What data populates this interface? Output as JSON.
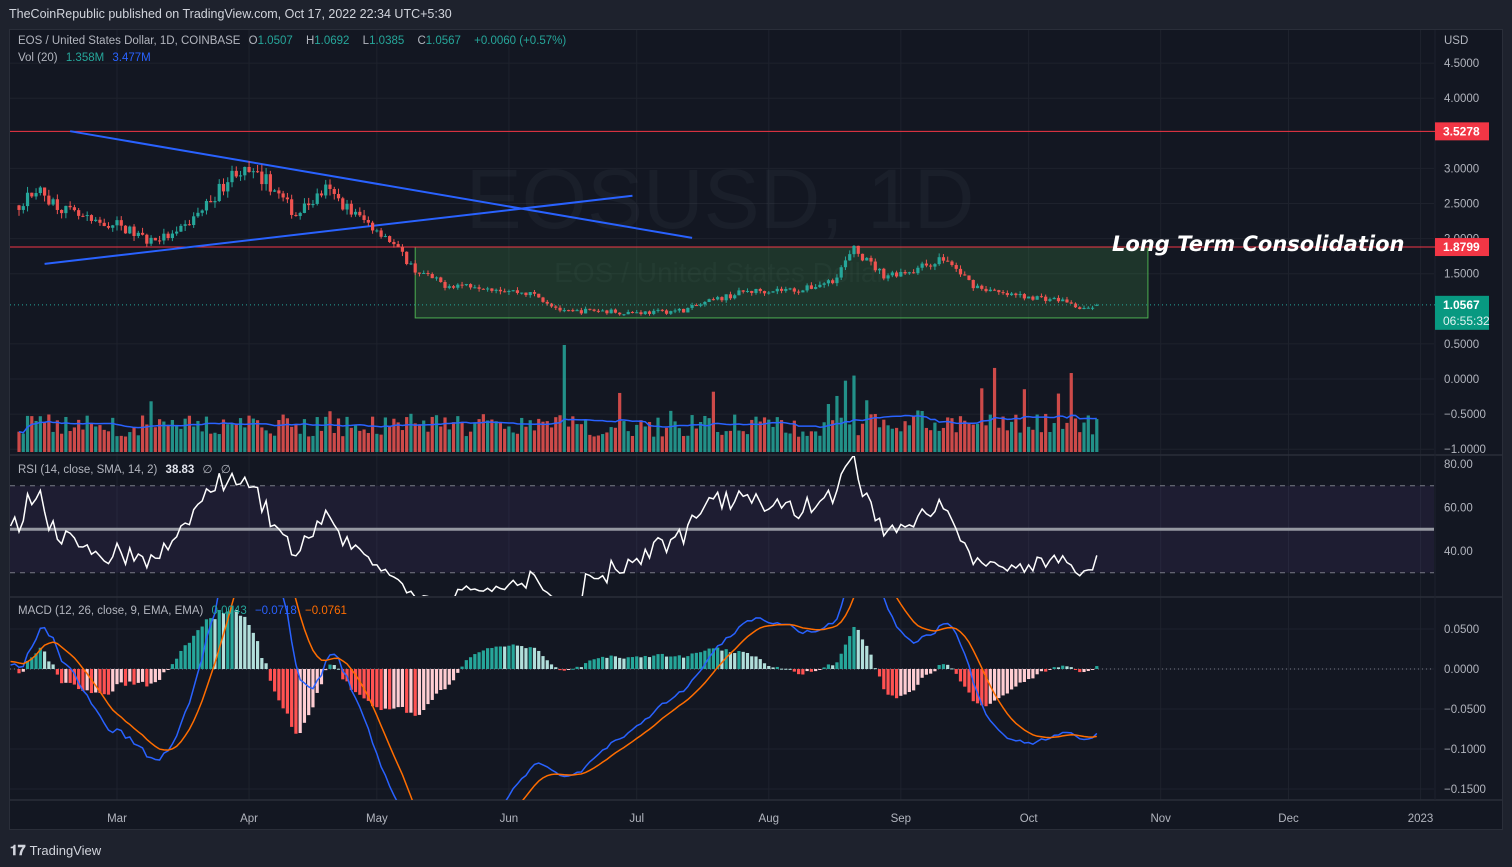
{
  "header": {
    "published": "TheCoinRepublic published on TradingView.com, Oct 17, 2022 22:34 UTC+5:30"
  },
  "legend": {
    "symbol": "EOS / United States Dollar, 1D, COINBASE",
    "o_label": "O",
    "o": "1.0507",
    "h_label": "H",
    "h": "1.0692",
    "l_label": "L",
    "l": "1.0385",
    "c_label": "C",
    "c": "1.0567",
    "change": "+0.0060 (+0.57%)",
    "vol_label": "Vol (20)",
    "vol": "1.358M",
    "vol_ma": "3.477M",
    "rsi_label": "RSI (14, close, SMA, 14, 2)",
    "rsi_value": "38.83",
    "rsi_extra1": "∅",
    "rsi_extra2": "∅",
    "macd_label": "MACD (12, 26, close, 9, EMA, EMA)",
    "macd_hist": "0.0043",
    "macd_line": "−0.0718",
    "macd_signal": "−0.0761"
  },
  "watermark": {
    "line1": "EOSUSD, 1D",
    "line2": "EOS / United States Dollar"
  },
  "annotation": {
    "text": "Long Term Consolidation"
  },
  "price_axis": {
    "unit": "USD",
    "ticks": [
      "4.5000",
      "4.0000",
      "3.0000",
      "2.5000",
      "2.0000",
      "1.5000",
      "0.5000",
      "0.0000",
      "−0.5000",
      "−1.0000"
    ],
    "tick_values": [
      4.5,
      4,
      3,
      2.5,
      2,
      1.5,
      0.5,
      0,
      -0.5,
      -1
    ],
    "resistance_label": "3.5278",
    "support_label": "1.8799",
    "last_price": "1.0567",
    "countdown": "06:55:32"
  },
  "rsi_axis": {
    "ticks": [
      "80.00",
      "60.00",
      "40.00"
    ],
    "tick_values": [
      80,
      60,
      40
    ]
  },
  "macd_axis": {
    "ticks": [
      "0.0500",
      "0.0000",
      "−0.0500",
      "−0.1000",
      "−0.1500"
    ],
    "tick_values": [
      0.05,
      0,
      -0.05,
      -0.1,
      -0.15
    ]
  },
  "time_axis": {
    "labels": [
      "Mar",
      "Apr",
      "May",
      "Jun",
      "Jul",
      "Aug",
      "Sep",
      "Oct",
      "Nov",
      "Dec",
      "2023"
    ],
    "dates": [
      "2022-03-01",
      "2022-04-01",
      "2022-05-01",
      "2022-06-01",
      "2022-07-01",
      "2022-08-01",
      "2022-09-01",
      "2022-10-01",
      "2022-11-01",
      "2022-12-01",
      "2023-01-01"
    ]
  },
  "footer": {
    "brand": "TradingView"
  },
  "colors": {
    "up": "#26a69a",
    "down": "#ef5350",
    "level": "#f23645",
    "trend": "#2962ff",
    "box": "#4caf50",
    "macd": "#2962ff",
    "signal": "#ff6d00",
    "rsi": "#ffffff"
  },
  "chart_data": {
    "type": "candlestick",
    "title": "EOS / United States Dollar, 1D, COINBASE",
    "ylabel": "USD",
    "ylim": [
      -1.0,
      4.7
    ],
    "close_anchors": [
      [
        "2022-01-20",
        2.5
      ],
      [
        "2022-02-05",
        2.41
      ],
      [
        "2022-02-10",
        2.7
      ],
      [
        "2022-02-17",
        2.4
      ],
      [
        "2022-02-24",
        2.2
      ],
      [
        "2022-03-01",
        2.2
      ],
      [
        "2022-03-08",
        1.98
      ],
      [
        "2022-03-15",
        2.05
      ],
      [
        "2022-03-22",
        2.48
      ],
      [
        "2022-03-29",
        2.98
      ],
      [
        "2022-04-05",
        2.83
      ],
      [
        "2022-04-12",
        2.34
      ],
      [
        "2022-04-19",
        2.7
      ],
      [
        "2022-04-26",
        2.34
      ],
      [
        "2022-05-03",
        2.05
      ],
      [
        "2022-05-10",
        1.55
      ],
      [
        "2022-05-17",
        1.34
      ],
      [
        "2022-05-24",
        1.34
      ],
      [
        "2022-05-31",
        1.27
      ],
      [
        "2022-06-07",
        1.2
      ],
      [
        "2022-06-14",
        0.95
      ],
      [
        "2022-06-21",
        0.98
      ],
      [
        "2022-06-28",
        0.95
      ],
      [
        "2022-07-05",
        0.95
      ],
      [
        "2022-07-12",
        0.98
      ],
      [
        "2022-07-19",
        1.12
      ],
      [
        "2022-07-26",
        1.24
      ],
      [
        "2022-08-02",
        1.27
      ],
      [
        "2022-08-09",
        1.27
      ],
      [
        "2022-08-16",
        1.41
      ],
      [
        "2022-08-21",
        1.84
      ],
      [
        "2022-08-28",
        1.48
      ],
      [
        "2022-09-04",
        1.55
      ],
      [
        "2022-09-11",
        1.72
      ],
      [
        "2022-09-18",
        1.34
      ],
      [
        "2022-09-25",
        1.2
      ],
      [
        "2022-10-02",
        1.17
      ],
      [
        "2022-10-09",
        1.12
      ],
      [
        "2022-10-14",
        0.98
      ],
      [
        "2022-10-17",
        1.0567
      ]
    ],
    "volume_spikes": [
      [
        "2022-06-14",
        4.2
      ],
      [
        "2022-08-19",
        2.8
      ],
      [
        "2022-08-21",
        3.0
      ],
      [
        "2022-09-23",
        3.3
      ],
      [
        "2022-10-11",
        3.1
      ],
      [
        "2022-04-20",
        1.6
      ],
      [
        "2022-05-09",
        1.5
      ],
      [
        "2022-06-16",
        1.4
      ],
      [
        "2022-08-17",
        2.2
      ],
      [
        "2022-09-20",
        2.5
      ]
    ],
    "horizontal_levels": [
      3.5278,
      1.8799
    ],
    "trendlines": [
      {
        "from": [
          "2022-02-18",
          3.53
        ],
        "to": [
          "2022-07-14",
          2.01
        ]
      },
      {
        "from": [
          "2022-02-12",
          1.64
        ],
        "to": [
          "2022-06-30",
          2.61
        ]
      }
    ],
    "consolidation_box": {
      "from": "2022-05-10",
      "to": "2022-10-29",
      "top": 1.88,
      "bottom": 0.87
    },
    "last": {
      "open": 1.0507,
      "high": 1.0692,
      "low": 1.0385,
      "close": 1.0567
    },
    "rsi": {
      "period": 14,
      "upper": 70,
      "middle": 50,
      "lower": 30,
      "last": 38.83
    },
    "macd": {
      "fast": 12,
      "slow": 26,
      "signal": 9,
      "hist": 0.0043,
      "macd": -0.0718,
      "signal_value": -0.0761
    }
  }
}
